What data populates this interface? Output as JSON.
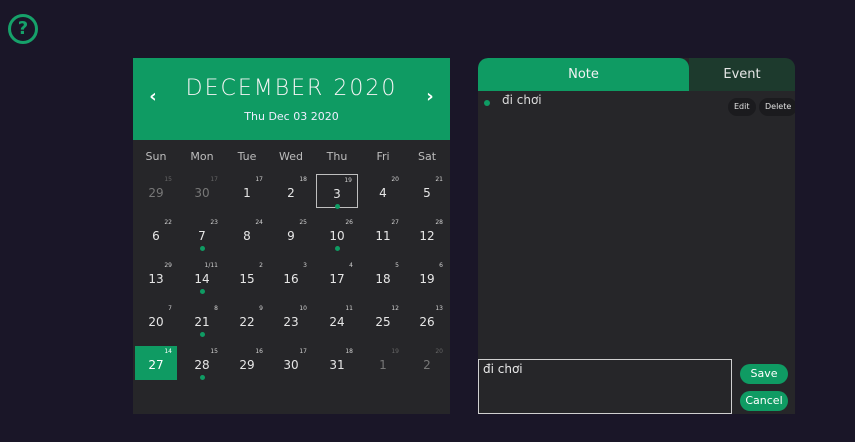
{
  "help": {
    "glyph": "?"
  },
  "calendar": {
    "month_label": "DECEMBER 2020",
    "selected_date_label": "Thu Dec 03 2020",
    "prev_glyph": "‹",
    "next_glyph": "›",
    "weekdays": [
      "Sun",
      "Mon",
      "Tue",
      "Wed",
      "Thu",
      "Fri",
      "Sat"
    ],
    "weeks": [
      [
        {
          "day": "29",
          "lunar": "15",
          "other": true
        },
        {
          "day": "30",
          "lunar": "17",
          "other": true
        },
        {
          "day": "1",
          "lunar": "17"
        },
        {
          "day": "2",
          "lunar": "18"
        },
        {
          "day": "3",
          "lunar": "19",
          "selected": true,
          "dot": true
        },
        {
          "day": "4",
          "lunar": "20"
        },
        {
          "day": "5",
          "lunar": "21"
        }
      ],
      [
        {
          "day": "6",
          "lunar": "22"
        },
        {
          "day": "7",
          "lunar": "23",
          "dot": true
        },
        {
          "day": "8",
          "lunar": "24"
        },
        {
          "day": "9",
          "lunar": "25"
        },
        {
          "day": "10",
          "lunar": "26",
          "dot": true
        },
        {
          "day": "11",
          "lunar": "27"
        },
        {
          "day": "12",
          "lunar": "28"
        }
      ],
      [
        {
          "day": "13",
          "lunar": "29"
        },
        {
          "day": "14",
          "lunar": "1/11",
          "dot": true
        },
        {
          "day": "15",
          "lunar": "2"
        },
        {
          "day": "16",
          "lunar": "3"
        },
        {
          "day": "17",
          "lunar": "4"
        },
        {
          "day": "18",
          "lunar": "5"
        },
        {
          "day": "19",
          "lunar": "6"
        }
      ],
      [
        {
          "day": "20",
          "lunar": "7"
        },
        {
          "day": "21",
          "lunar": "8",
          "dot": true
        },
        {
          "day": "22",
          "lunar": "9"
        },
        {
          "day": "23",
          "lunar": "10"
        },
        {
          "day": "24",
          "lunar": "11"
        },
        {
          "day": "25",
          "lunar": "12"
        },
        {
          "day": "26",
          "lunar": "13"
        }
      ],
      [
        {
          "day": "27",
          "lunar": "14",
          "today": true
        },
        {
          "day": "28",
          "lunar": "15",
          "dot": true
        },
        {
          "day": "29",
          "lunar": "16"
        },
        {
          "day": "30",
          "lunar": "17"
        },
        {
          "day": "31",
          "lunar": "18"
        },
        {
          "day": "1",
          "lunar": "19",
          "other": true
        },
        {
          "day": "2",
          "lunar": "20",
          "other": true
        }
      ]
    ]
  },
  "notes": {
    "tab_note": "Note",
    "tab_event": "Event",
    "items": [
      {
        "text": "đi chơi",
        "edit_label": "Edit",
        "delete_label": "Delete"
      }
    ],
    "editor_value": "đi chơi",
    "save_label": "Save",
    "cancel_label": "Cancel"
  },
  "colors": {
    "accent": "#0f9b63",
    "panel": "#262629",
    "background": "#1a1628"
  }
}
